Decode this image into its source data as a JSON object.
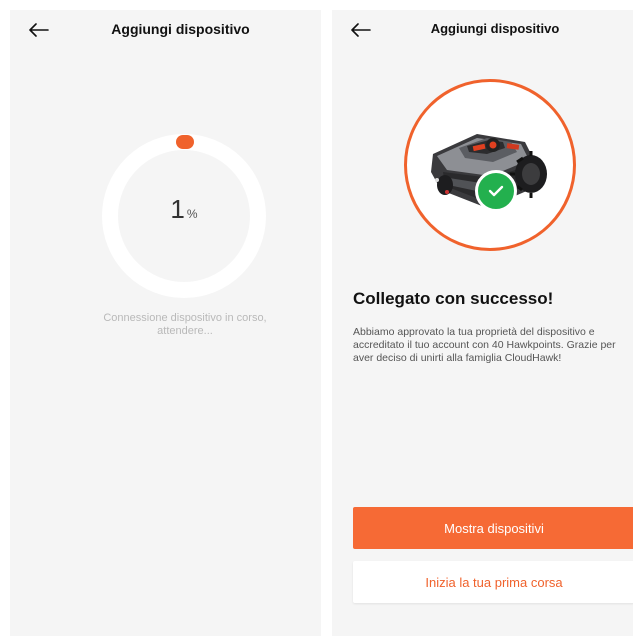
{
  "left_screen": {
    "title": "Aggiungi dispositivo",
    "progress": {
      "value": "1",
      "unit": "%",
      "fraction": 0.01
    },
    "status_text": "Connessione dispositivo in corso, attendere..."
  },
  "right_screen": {
    "title": "Aggiungi dispositivo",
    "success_title": "Collegato con successo!",
    "success_message": "Abbiamo approvato la tua proprietà del dispositivo e accreditato il tuo account con 40 Hawkpoints. Grazie per aver deciso di unirti alla famiglia CloudHawk!",
    "primary_button": "Mostra dispositivi",
    "secondary_button": "Inizia la tua prima corsa"
  },
  "colors": {
    "accent": "#f66a35",
    "ring": "#ffffff",
    "success": "#23b04e",
    "background": "#f5f5f5"
  },
  "icons": [
    "back-arrow-icon",
    "checkmark-icon",
    "robotic-mower-image"
  ]
}
